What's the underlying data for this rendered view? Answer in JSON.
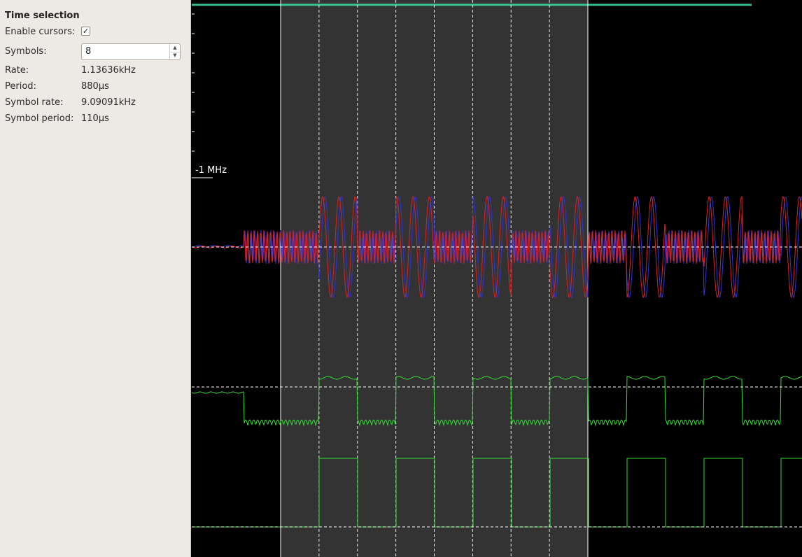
{
  "panel": {
    "title": "Time selection",
    "enable_cursors_label": "Enable cursors:",
    "enable_cursors_checked": true,
    "symbols_label": "Symbols:",
    "symbols_value": "8",
    "rate_label": "Rate:",
    "rate_value": "1.13636kHz",
    "period_label": "Period:",
    "period_value": "880µs",
    "symbol_rate_label": "Symbol rate:",
    "symbol_rate_value": "9.09091kHz",
    "symbol_period_label": "Symbol period:",
    "symbol_period_value": "110µs"
  },
  "plot": {
    "frequency_label": "-1 MHz",
    "bit_pattern": [
      0,
      1,
      0,
      1,
      0,
      1,
      0,
      1,
      0,
      1,
      0,
      1,
      0,
      1,
      0,
      1
    ],
    "colors": {
      "background": "#000000",
      "selection": "#333333",
      "i_trace": "#dd2222",
      "q_trace": "#3333dd",
      "amplitude_trace": "#33dd33",
      "threshold_trace": "#33dd33",
      "cursor": "#ffffff",
      "waterfall": "#3fd6a0"
    }
  }
}
